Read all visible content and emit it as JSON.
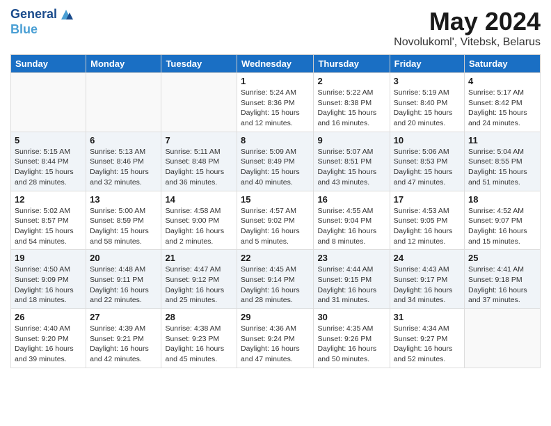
{
  "header": {
    "logo_line1": "General",
    "logo_line2": "Blue",
    "month": "May 2024",
    "location": "Novolukoml', Vitebsk, Belarus"
  },
  "days_of_week": [
    "Sunday",
    "Monday",
    "Tuesday",
    "Wednesday",
    "Thursday",
    "Friday",
    "Saturday"
  ],
  "weeks": [
    [
      {
        "num": "",
        "info": ""
      },
      {
        "num": "",
        "info": ""
      },
      {
        "num": "",
        "info": ""
      },
      {
        "num": "1",
        "info": "Sunrise: 5:24 AM\nSunset: 8:36 PM\nDaylight: 15 hours\nand 12 minutes."
      },
      {
        "num": "2",
        "info": "Sunrise: 5:22 AM\nSunset: 8:38 PM\nDaylight: 15 hours\nand 16 minutes."
      },
      {
        "num": "3",
        "info": "Sunrise: 5:19 AM\nSunset: 8:40 PM\nDaylight: 15 hours\nand 20 minutes."
      },
      {
        "num": "4",
        "info": "Sunrise: 5:17 AM\nSunset: 8:42 PM\nDaylight: 15 hours\nand 24 minutes."
      }
    ],
    [
      {
        "num": "5",
        "info": "Sunrise: 5:15 AM\nSunset: 8:44 PM\nDaylight: 15 hours\nand 28 minutes."
      },
      {
        "num": "6",
        "info": "Sunrise: 5:13 AM\nSunset: 8:46 PM\nDaylight: 15 hours\nand 32 minutes."
      },
      {
        "num": "7",
        "info": "Sunrise: 5:11 AM\nSunset: 8:48 PM\nDaylight: 15 hours\nand 36 minutes."
      },
      {
        "num": "8",
        "info": "Sunrise: 5:09 AM\nSunset: 8:49 PM\nDaylight: 15 hours\nand 40 minutes."
      },
      {
        "num": "9",
        "info": "Sunrise: 5:07 AM\nSunset: 8:51 PM\nDaylight: 15 hours\nand 43 minutes."
      },
      {
        "num": "10",
        "info": "Sunrise: 5:06 AM\nSunset: 8:53 PM\nDaylight: 15 hours\nand 47 minutes."
      },
      {
        "num": "11",
        "info": "Sunrise: 5:04 AM\nSunset: 8:55 PM\nDaylight: 15 hours\nand 51 minutes."
      }
    ],
    [
      {
        "num": "12",
        "info": "Sunrise: 5:02 AM\nSunset: 8:57 PM\nDaylight: 15 hours\nand 54 minutes."
      },
      {
        "num": "13",
        "info": "Sunrise: 5:00 AM\nSunset: 8:59 PM\nDaylight: 15 hours\nand 58 minutes."
      },
      {
        "num": "14",
        "info": "Sunrise: 4:58 AM\nSunset: 9:00 PM\nDaylight: 16 hours\nand 2 minutes."
      },
      {
        "num": "15",
        "info": "Sunrise: 4:57 AM\nSunset: 9:02 PM\nDaylight: 16 hours\nand 5 minutes."
      },
      {
        "num": "16",
        "info": "Sunrise: 4:55 AM\nSunset: 9:04 PM\nDaylight: 16 hours\nand 8 minutes."
      },
      {
        "num": "17",
        "info": "Sunrise: 4:53 AM\nSunset: 9:05 PM\nDaylight: 16 hours\nand 12 minutes."
      },
      {
        "num": "18",
        "info": "Sunrise: 4:52 AM\nSunset: 9:07 PM\nDaylight: 16 hours\nand 15 minutes."
      }
    ],
    [
      {
        "num": "19",
        "info": "Sunrise: 4:50 AM\nSunset: 9:09 PM\nDaylight: 16 hours\nand 18 minutes."
      },
      {
        "num": "20",
        "info": "Sunrise: 4:48 AM\nSunset: 9:11 PM\nDaylight: 16 hours\nand 22 minutes."
      },
      {
        "num": "21",
        "info": "Sunrise: 4:47 AM\nSunset: 9:12 PM\nDaylight: 16 hours\nand 25 minutes."
      },
      {
        "num": "22",
        "info": "Sunrise: 4:45 AM\nSunset: 9:14 PM\nDaylight: 16 hours\nand 28 minutes."
      },
      {
        "num": "23",
        "info": "Sunrise: 4:44 AM\nSunset: 9:15 PM\nDaylight: 16 hours\nand 31 minutes."
      },
      {
        "num": "24",
        "info": "Sunrise: 4:43 AM\nSunset: 9:17 PM\nDaylight: 16 hours\nand 34 minutes."
      },
      {
        "num": "25",
        "info": "Sunrise: 4:41 AM\nSunset: 9:18 PM\nDaylight: 16 hours\nand 37 minutes."
      }
    ],
    [
      {
        "num": "26",
        "info": "Sunrise: 4:40 AM\nSunset: 9:20 PM\nDaylight: 16 hours\nand 39 minutes."
      },
      {
        "num": "27",
        "info": "Sunrise: 4:39 AM\nSunset: 9:21 PM\nDaylight: 16 hours\nand 42 minutes."
      },
      {
        "num": "28",
        "info": "Sunrise: 4:38 AM\nSunset: 9:23 PM\nDaylight: 16 hours\nand 45 minutes."
      },
      {
        "num": "29",
        "info": "Sunrise: 4:36 AM\nSunset: 9:24 PM\nDaylight: 16 hours\nand 47 minutes."
      },
      {
        "num": "30",
        "info": "Sunrise: 4:35 AM\nSunset: 9:26 PM\nDaylight: 16 hours\nand 50 minutes."
      },
      {
        "num": "31",
        "info": "Sunrise: 4:34 AM\nSunset: 9:27 PM\nDaylight: 16 hours\nand 52 minutes."
      },
      {
        "num": "",
        "info": ""
      }
    ]
  ]
}
